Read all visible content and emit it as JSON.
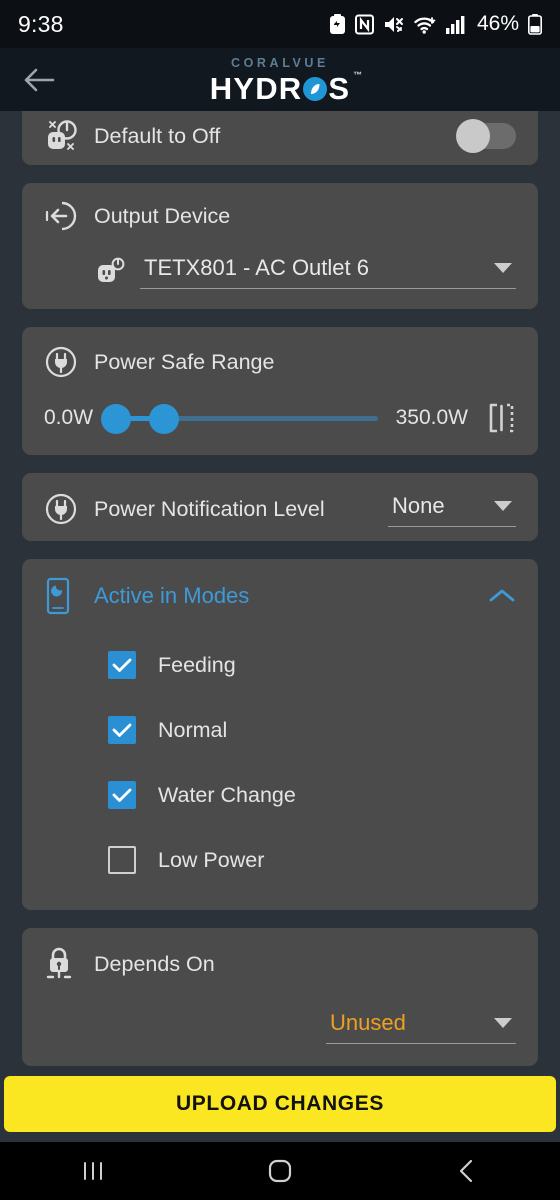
{
  "status_bar": {
    "time": "9:38",
    "battery_percent": "46%",
    "icons": [
      "battery-saver-icon",
      "nfc-icon",
      "mute-icon",
      "wifi-icon",
      "cellular-signal-icon",
      "battery-icon"
    ]
  },
  "app_bar": {
    "back_icon": "back-arrow-icon",
    "brand_top": "CORALVUE",
    "brand_main_left": "HYDR",
    "brand_main_right": "S",
    "trademark": "™"
  },
  "cards": {
    "default_to_off": {
      "icon": "outlet-power-off-icon",
      "label": "Default to Off",
      "toggle_state": "off"
    },
    "output_device": {
      "icon": "output-arrow-icon",
      "label": "Output Device",
      "value_icon": "ac-outlet-icon",
      "value": "TETX801 - AC Outlet 6",
      "caret": "chevron-down-icon"
    },
    "power_safe_range": {
      "icon": "power-plug-icon",
      "label": "Power Safe Range",
      "min_value": "0.0W",
      "max_value": "350.0W",
      "range_icon": "range-bracket-icon",
      "handle_low_pct": 2,
      "handle_high_pct": 20
    },
    "power_notification_level": {
      "icon": "power-plug-icon",
      "label": "Power Notification Level",
      "value": "None",
      "caret": "chevron-down-icon"
    },
    "active_in_modes": {
      "icon": "mode-phone-icon",
      "label": "Active in Modes",
      "expanded_icon": "chevron-up-icon",
      "modes": [
        {
          "label": "Feeding",
          "checked": true
        },
        {
          "label": "Normal",
          "checked": true
        },
        {
          "label": "Water Change",
          "checked": true
        },
        {
          "label": "Low Power",
          "checked": false
        }
      ]
    },
    "depends_on": {
      "icon": "lock-icon",
      "label": "Depends On",
      "value": "Unused",
      "caret": "chevron-down-icon"
    }
  },
  "footer": {
    "upload_label": "UPLOAD CHANGES"
  },
  "nav_bar": {
    "recents": "recents-icon",
    "home": "home-icon",
    "back": "back-icon"
  },
  "colors": {
    "page_bg": "#2b323a",
    "card_bg": "#4b4b4b",
    "accent_blue": "#2b95d6",
    "accent_orange": "#eda021",
    "upload_yellow": "#fbe721",
    "brand_blue": "#5e7c93"
  }
}
